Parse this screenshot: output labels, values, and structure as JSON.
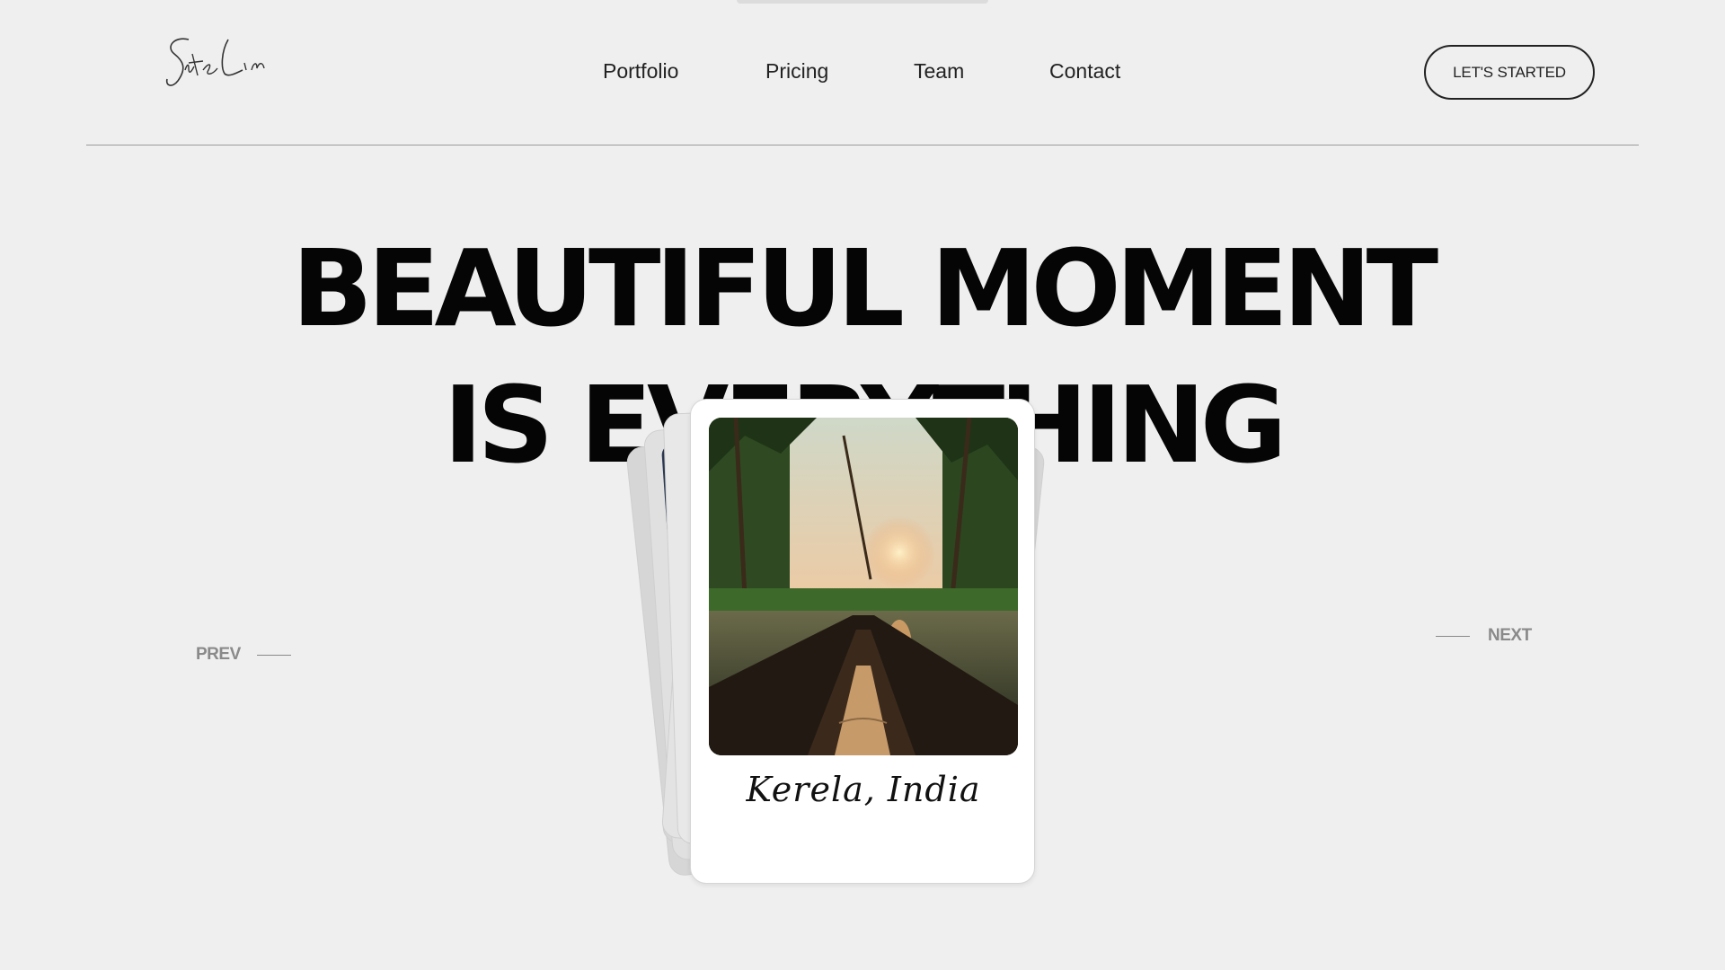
{
  "header": {
    "logo_text": "SiteLin",
    "nav": [
      "Portfolio",
      "Pricing",
      "Team",
      "Contact"
    ],
    "cta_label": "LET'S STARTED"
  },
  "hero": {
    "line1": "BEAUTIFUL MOMENT",
    "line2": "IS EVERYTHING"
  },
  "carousel": {
    "prev_label": "PREV",
    "next_label": "NEXT",
    "card_caption": "Kerela, India",
    "card_photo_icon": "backwater-boat-photo"
  },
  "colors": {
    "background": "#efefef",
    "text": "#050505",
    "muted": "#8a8a8a"
  }
}
